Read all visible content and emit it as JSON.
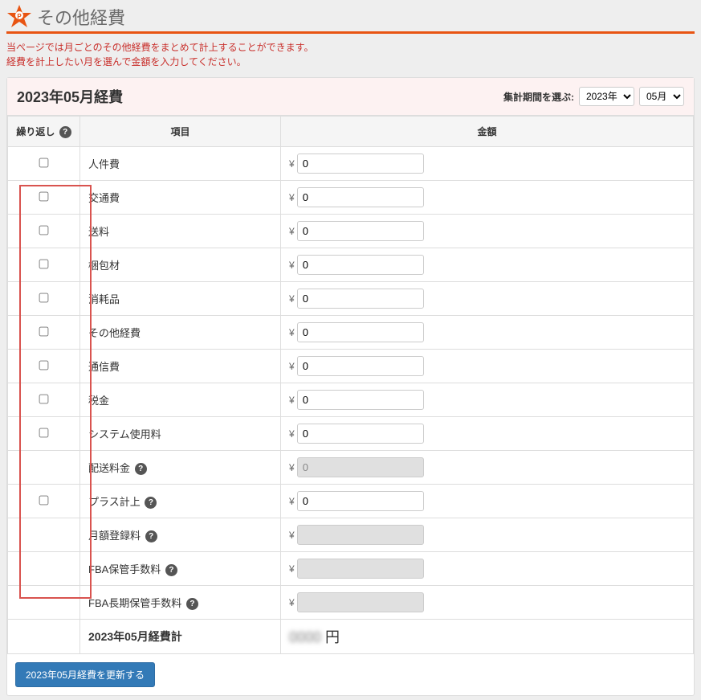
{
  "header": {
    "title": "その他経費"
  },
  "description": {
    "line1": "当ぺージでは月ごとのその他経費をまとめて計上することができます。",
    "line2": "経費を計上したい月を選んで金額を入力してください。"
  },
  "panel": {
    "month_title": "2023年05月経費",
    "period_label": "集計期間を選ぶ:",
    "year_selected": "2023年",
    "month_selected": "05月"
  },
  "table": {
    "headers": {
      "repeat": "繰り返し",
      "item": "項目",
      "amount": "金額"
    },
    "rows": [
      {
        "checkable": true,
        "label": "人件費",
        "value": "0",
        "disabled": false,
        "help": false
      },
      {
        "checkable": true,
        "label": "交通費",
        "value": "0",
        "disabled": false,
        "help": false
      },
      {
        "checkable": true,
        "label": "送料",
        "value": "0",
        "disabled": false,
        "help": false
      },
      {
        "checkable": true,
        "label": "梱包材",
        "value": "0",
        "disabled": false,
        "help": false
      },
      {
        "checkable": true,
        "label": "消耗品",
        "value": "0",
        "disabled": false,
        "help": false
      },
      {
        "checkable": true,
        "label": "その他経費",
        "value": "0",
        "disabled": false,
        "help": false
      },
      {
        "checkable": true,
        "label": "通信費",
        "value": "0",
        "disabled": false,
        "help": false
      },
      {
        "checkable": true,
        "label": "税金",
        "value": "0",
        "disabled": false,
        "help": false
      },
      {
        "checkable": true,
        "label": "システム使用料",
        "value": "0",
        "disabled": false,
        "help": false
      },
      {
        "checkable": false,
        "label": "配送料金",
        "value": "0",
        "disabled": true,
        "help": true
      },
      {
        "checkable": true,
        "label": "プラス計上",
        "value": "0",
        "disabled": false,
        "help": true
      },
      {
        "checkable": false,
        "label": "月額登録料",
        "value": "",
        "disabled": true,
        "help": true,
        "blur": true
      },
      {
        "checkable": false,
        "label": "FBA保管手数料",
        "value": "",
        "disabled": true,
        "help": true,
        "blur": true,
        "nohighlight": true
      },
      {
        "checkable": false,
        "label": "FBA長期保管手数料",
        "value": "",
        "disabled": true,
        "help": true,
        "blur": true,
        "nohighlight": true
      }
    ],
    "total": {
      "label": "2023年05月経費計",
      "amount_suffix": "円"
    }
  },
  "footer": {
    "update_button": "2023年05月経費を更新する"
  }
}
